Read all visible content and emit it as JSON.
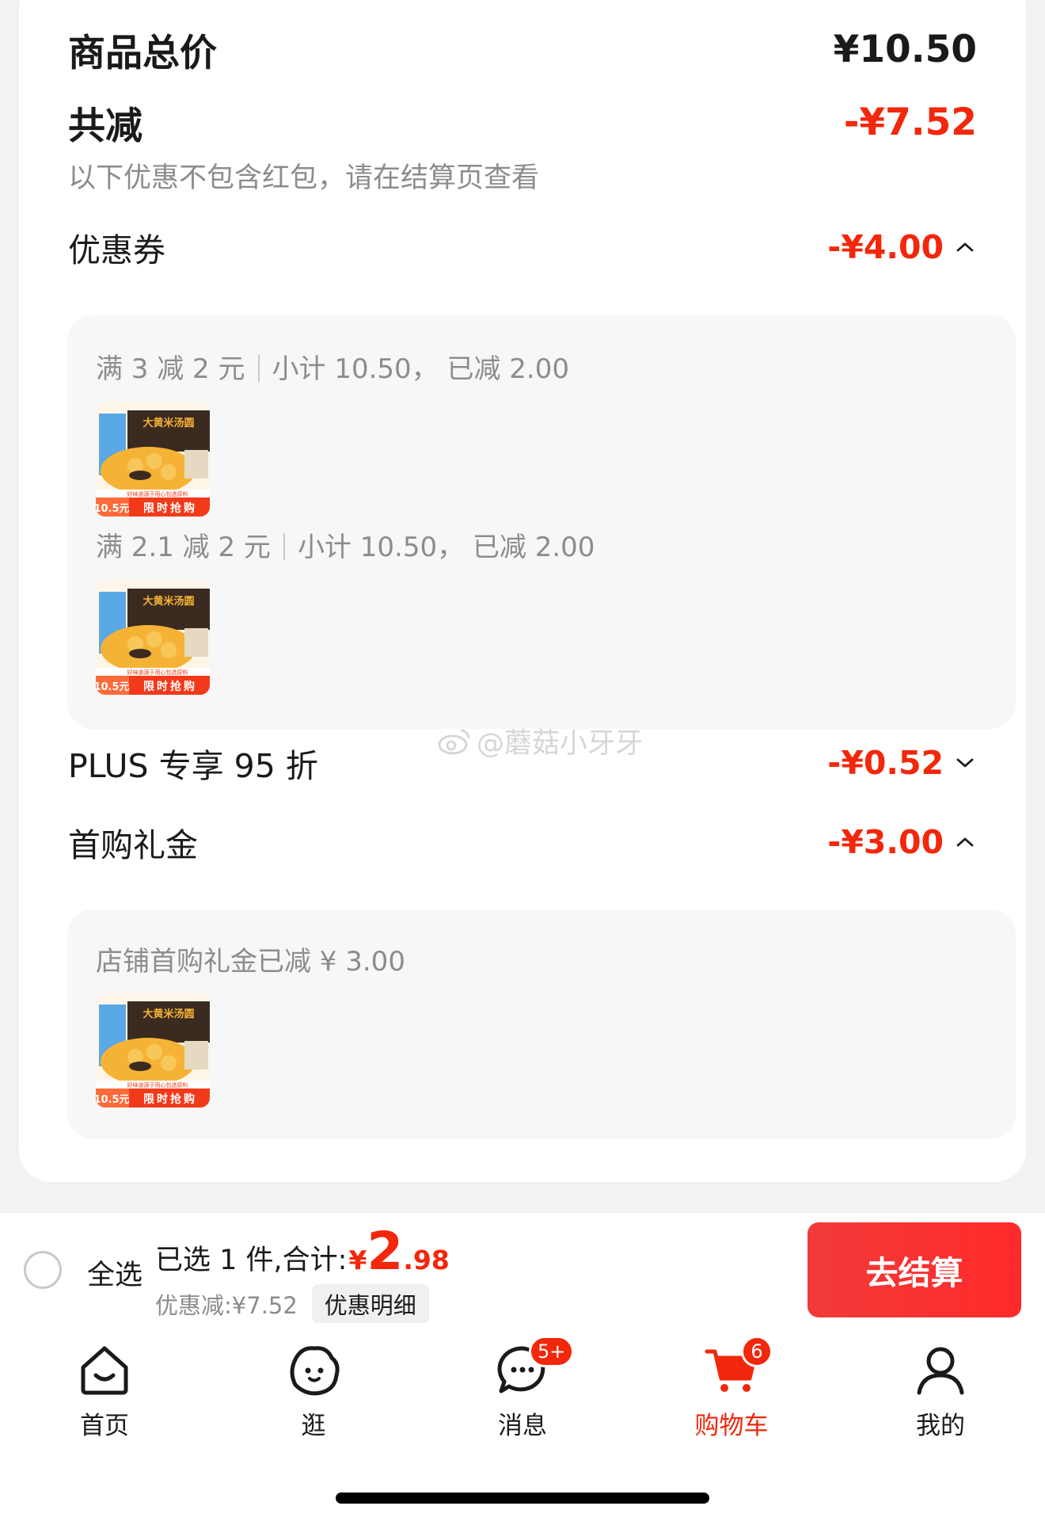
{
  "summary": {
    "total_label": "商品总价",
    "total_value": "¥10.50",
    "reduce_label": "共减",
    "reduce_value": "-¥7.52",
    "note": "以下优惠不包含红包，请在结算页查看"
  },
  "coupon": {
    "label": "优惠券",
    "amount": "-¥4.00",
    "expanded": true,
    "rules": [
      {
        "condition": "满 3 减 2 元",
        "detail": "小计 10.50， 已减 2.00"
      },
      {
        "condition": "满 2.1 减 2 元",
        "detail": "小计 10.50， 已减 2.00"
      }
    ]
  },
  "plus": {
    "label": "PLUS 专享 95 折",
    "amount": "-¥0.52",
    "expanded": false
  },
  "first_buy": {
    "label": "首购礼金",
    "amount": "-¥3.00",
    "expanded": true,
    "rule": "店铺首购礼金已减 ¥ 3.00"
  },
  "product_thumb": {
    "brand_text": "大黄米汤圆",
    "price_tag": "10.5",
    "price_unit": "元",
    "flash_text": "限时抢购",
    "slogan": "好味道源于用心包选原料",
    "colors": {
      "bowl": "#f5b335",
      "banner": "#f23a1a",
      "side": "#5aa8e6"
    }
  },
  "watermark": "@蘑菇小牙牙",
  "checkout": {
    "select_all": "全选",
    "selected_text": "已选 1 件,合计:",
    "currency": "¥",
    "total_int": "2",
    "total_dec": ".98",
    "discount_text": "优惠减:¥7.52",
    "detail_button": "优惠明细",
    "pay_button": "去结算"
  },
  "tabs": [
    {
      "label": "首页",
      "icon": "home-icon"
    },
    {
      "label": "逛",
      "icon": "stroll-icon"
    },
    {
      "label": "消息",
      "icon": "message-icon",
      "badge": "5+"
    },
    {
      "label": "购物车",
      "icon": "cart-icon",
      "badge": "6",
      "active": true
    },
    {
      "label": "我的",
      "icon": "profile-icon"
    }
  ],
  "colors": {
    "accent": "#f2270c",
    "panel": "#f7f7f7",
    "text": "#1a1a1a",
    "muted": "#8c8c8c"
  }
}
